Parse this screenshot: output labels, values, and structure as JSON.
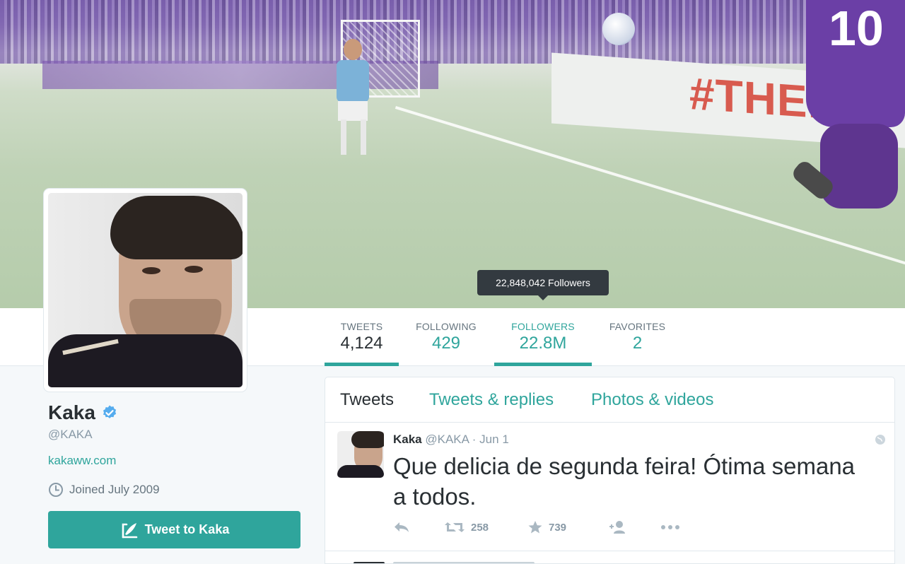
{
  "banner": {
    "wall_text": "#THERE",
    "jersey_number": "10"
  },
  "tooltip": {
    "text": "22,848,042 Followers"
  },
  "stats": [
    {
      "label": "TWEETS",
      "value": "4,124"
    },
    {
      "label": "FOLLOWING",
      "value": "429"
    },
    {
      "label": "FOLLOWERS",
      "value": "22.8M"
    },
    {
      "label": "FAVORITES",
      "value": "2"
    }
  ],
  "profile": {
    "name": "Kaka",
    "handle": "@KAKA",
    "website": "kakaww.com",
    "joined": "Joined July 2009",
    "tweet_to_label": "Tweet to Kaka"
  },
  "timeline": {
    "tabs": [
      {
        "label": "Tweets"
      },
      {
        "label": "Tweets & replies"
      },
      {
        "label": "Photos & videos"
      }
    ],
    "tweet": {
      "name": "Kaka",
      "handle": "@KAKA",
      "time": "· Jun 1",
      "text": "Que delicia de segunda feira! Ótima semana a todos.",
      "retweets": "258",
      "favorites": "739"
    }
  },
  "colors": {
    "accent": "#2fa59c",
    "verified": "#55acee",
    "tooltip_bg": "#333a40"
  },
  "icons": [
    "verified-badge-icon",
    "clock-icon",
    "quill-icon",
    "globe-icon",
    "reply-icon",
    "retweet-icon",
    "star-icon",
    "follow-icon",
    "more-icon"
  ]
}
